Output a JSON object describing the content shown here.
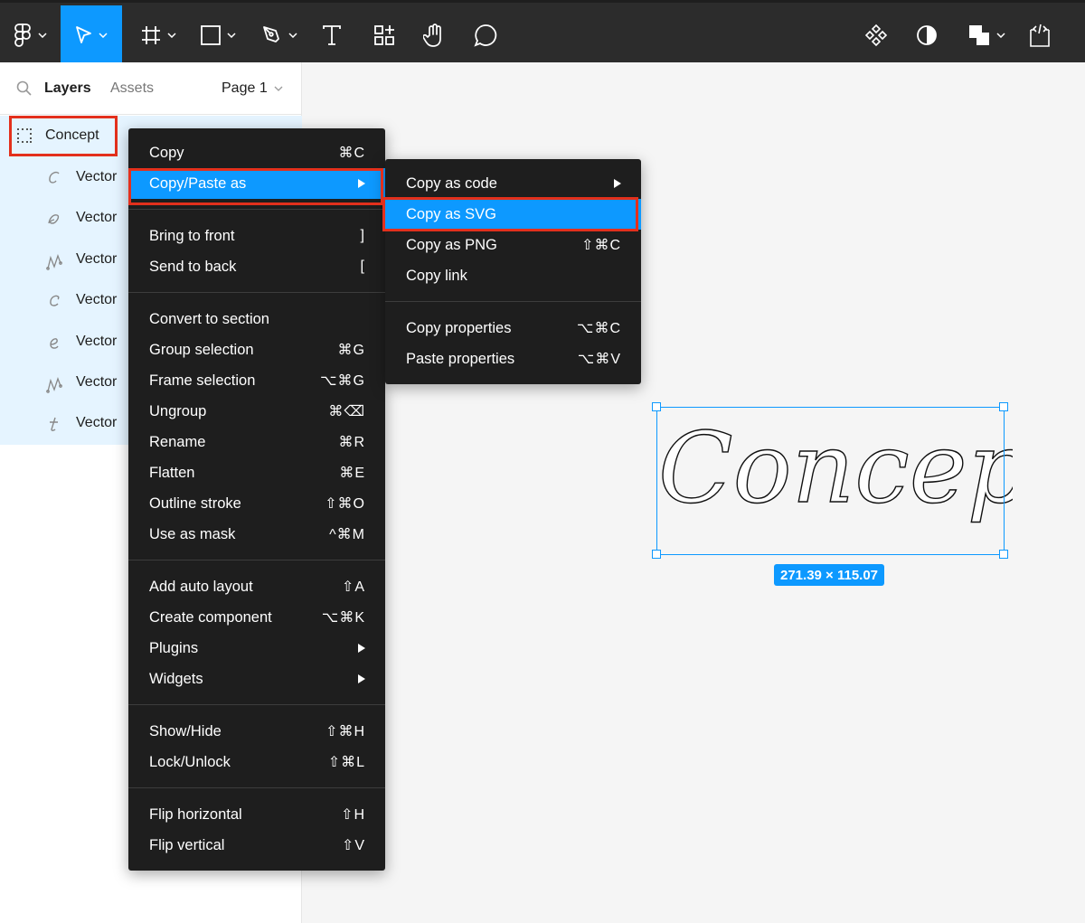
{
  "toolbar": {
    "tools": [
      {
        "name": "main-menu",
        "icon": "figma-logo-icon"
      },
      {
        "name": "move-tool",
        "icon": "cursor-arrow-icon",
        "active": true
      },
      {
        "name": "frame-tool",
        "icon": "hash-frame-icon"
      },
      {
        "name": "shape-tool",
        "icon": "rectangle-icon"
      },
      {
        "name": "pen-tool",
        "icon": "pen-icon"
      },
      {
        "name": "text-tool",
        "icon": "text-t-icon"
      },
      {
        "name": "resources-tool",
        "icon": "resources-icon"
      },
      {
        "name": "hand-tool",
        "icon": "hand-icon"
      },
      {
        "name": "comment-tool",
        "icon": "comment-bubble-icon"
      }
    ],
    "right_tools": [
      {
        "name": "component-tool",
        "icon": "component-diamond-icon"
      },
      {
        "name": "contrast-tool",
        "icon": "contrast-circle-icon"
      },
      {
        "name": "boolean-tool",
        "icon": "boolean-union-icon"
      },
      {
        "name": "dev-mode-tool",
        "icon": "code-frame-icon"
      }
    ]
  },
  "left_panel": {
    "tab_layers": "Layers",
    "tab_assets": "Assets",
    "page_name": "Page 1",
    "layers": [
      {
        "name": "Concept",
        "icon": "frame-dotted-icon"
      },
      {
        "name": "Vector",
        "icon": "vector-c-icon"
      },
      {
        "name": "Vector",
        "icon": "vector-o-icon"
      },
      {
        "name": "Vector",
        "icon": "vector-n-icon"
      },
      {
        "name": "Vector",
        "icon": "vector-c2-icon"
      },
      {
        "name": "Vector",
        "icon": "vector-e-icon"
      },
      {
        "name": "Vector",
        "icon": "vector-p-icon"
      },
      {
        "name": "Vector",
        "icon": "vector-t-icon"
      }
    ]
  },
  "context_menu": {
    "groups": [
      [
        {
          "label": "Copy",
          "shortcut": "⌘C"
        },
        {
          "label": "Copy/Paste as",
          "submenu": true,
          "selected": true
        }
      ],
      [
        {
          "label": "Bring to front",
          "shortcut": "]"
        },
        {
          "label": "Send to back",
          "shortcut": "["
        }
      ],
      [
        {
          "label": "Convert to section",
          "shortcut": ""
        },
        {
          "label": "Group selection",
          "shortcut": "⌘G"
        },
        {
          "label": "Frame selection",
          "shortcut": "⌥⌘G"
        },
        {
          "label": "Ungroup",
          "shortcut": "⌘⌫"
        },
        {
          "label": "Rename",
          "shortcut": "⌘R"
        },
        {
          "label": "Flatten",
          "shortcut": "⌘E"
        },
        {
          "label": "Outline stroke",
          "shortcut": "⇧⌘O"
        },
        {
          "label": "Use as mask",
          "shortcut": "^⌘M"
        }
      ],
      [
        {
          "label": "Add auto layout",
          "shortcut": "⇧A"
        },
        {
          "label": "Create component",
          "shortcut": "⌥⌘K"
        },
        {
          "label": "Plugins",
          "submenu": true
        },
        {
          "label": "Widgets",
          "submenu": true
        }
      ],
      [
        {
          "label": "Show/Hide",
          "shortcut": "⇧⌘H"
        },
        {
          "label": "Lock/Unlock",
          "shortcut": "⇧⌘L"
        }
      ],
      [
        {
          "label": "Flip horizontal",
          "shortcut": "⇧H"
        },
        {
          "label": "Flip vertical",
          "shortcut": "⇧V"
        }
      ]
    ]
  },
  "submenu": {
    "groups": [
      [
        {
          "label": "Copy as code",
          "submenu": true
        },
        {
          "label": "Copy as SVG",
          "shortcut": "",
          "selected": true
        },
        {
          "label": "Copy as PNG",
          "shortcut": "⇧⌘C"
        },
        {
          "label": "Copy link",
          "shortcut": ""
        }
      ],
      [
        {
          "label": "Copy properties",
          "shortcut": "⌥⌘C"
        },
        {
          "label": "Paste properties",
          "shortcut": "⌥⌘V"
        }
      ]
    ]
  },
  "canvas": {
    "selection_size": "271.39 × 115.07",
    "artwork_text": "Concept"
  },
  "colors": {
    "accent": "#0d99ff",
    "highlight_red": "#e3301c",
    "toolbar": "#2c2c2c",
    "menu": "#1e1e1e"
  }
}
